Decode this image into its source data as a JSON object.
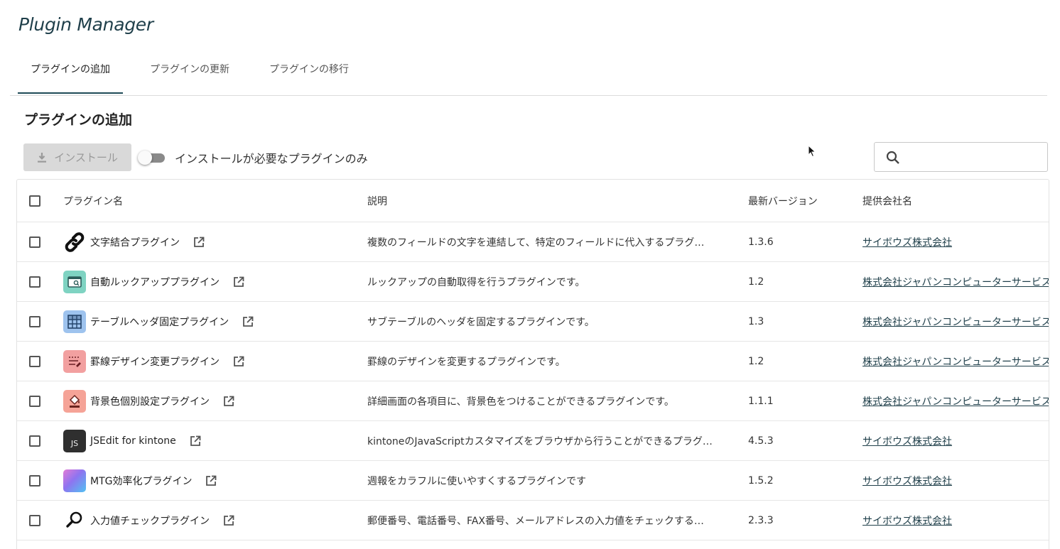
{
  "app": {
    "title": "Plugin Manager"
  },
  "tabs": [
    {
      "label": "プラグインの追加",
      "active": true
    },
    {
      "label": "プラグインの更新",
      "active": false
    },
    {
      "label": "プラグインの移行",
      "active": false
    }
  ],
  "section": {
    "title": "プラグインの追加"
  },
  "toolbar": {
    "install_label": "インストール",
    "toggle_label": "インストールが必要なプラグインのみ",
    "toggle_on": false,
    "search_placeholder": ""
  },
  "table": {
    "headers": {
      "name": "プラグイン名",
      "description": "説明",
      "version": "最新バージョン",
      "vendor": "提供会社名"
    },
    "rows": [
      {
        "name": "文字結合プラグイン",
        "icon": "chain-link-icon",
        "description": "複数のフィールドの文字を連結して、特定のフィールドに代入するプラグ…",
        "version": "1.3.6",
        "vendor": "サイボウズ株式会社"
      },
      {
        "name": "自動ルックアッププラグイン",
        "icon": "auto-lookup-icon",
        "description": "ルックアップの自動取得を行うプラグインです。",
        "version": "1.2",
        "vendor": "株式会社ジャパンコンピューターサービス"
      },
      {
        "name": "テーブルヘッダ固定プラグイン",
        "icon": "table-grid-icon",
        "description": "サブテーブルのヘッダを固定するプラグインです。",
        "version": "1.3",
        "vendor": "株式会社ジャパンコンピューターサービス"
      },
      {
        "name": "罫線デザイン変更プラグイン",
        "icon": "border-design-icon",
        "description": "罫線のデザインを変更するプラグインです。",
        "version": "1.2",
        "vendor": "株式会社ジャパンコンピューターサービス"
      },
      {
        "name": "背景色個別設定プラグイン",
        "icon": "paint-bucket-icon",
        "description": "詳細画面の各項目に、背景色をつけることができるプラグインです。",
        "version": "1.1.1",
        "vendor": "株式会社ジャパンコンピューターサービス"
      },
      {
        "name": "JSEdit for kintone",
        "icon": "js-editor-icon",
        "icon_text": "JS",
        "description": "kintoneのJavaScriptカスタマイズをブラウザから行うことができるプラグ…",
        "version": "4.5.3",
        "vendor": "サイボウズ株式会社"
      },
      {
        "name": "MTG効率化プラグイン",
        "icon": "gradient-tile-icon",
        "description": "週報をカラフルに使いやすくするプラグインです",
        "version": "1.5.2",
        "vendor": "サイボウズ株式会社"
      },
      {
        "name": "入力値チェックプラグイン",
        "icon": "magnifier-check-icon",
        "description": "郵便番号、電話番号、FAX番号、メールアドレスの入力値をチェックする…",
        "version": "2.3.3",
        "vendor": "サイボウズ株式会社"
      }
    ]
  },
  "colors": {
    "accent": "#1f4a57",
    "install_disabled_bg": "#d9d9d9",
    "link": "#1f3f4a"
  }
}
